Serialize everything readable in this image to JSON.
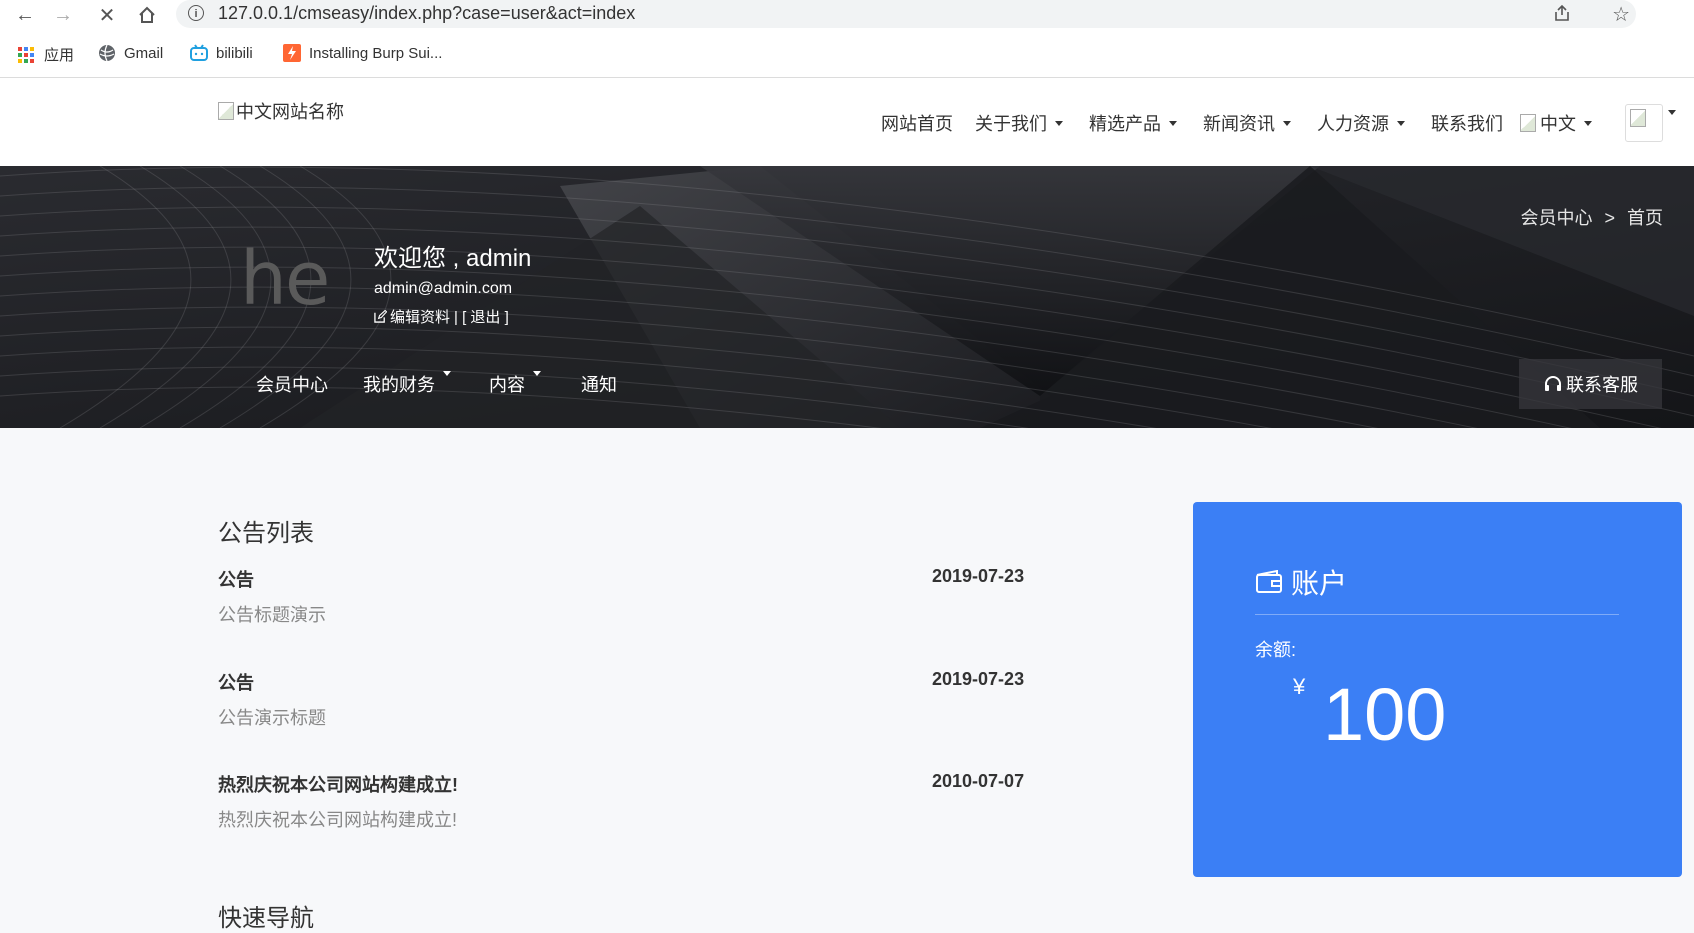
{
  "browser": {
    "url": "127.0.0.1/cmseasy/index.php?case=user&act=index",
    "bookmarks": [
      {
        "label": "应用",
        "icon": "apps-grid-icon"
      },
      {
        "label": "Gmail",
        "icon": "globe-icon"
      },
      {
        "label": "bilibili",
        "icon": "bilibili-icon"
      },
      {
        "label": "Installing Burp Sui...",
        "icon": "burp-icon"
      }
    ]
  },
  "header": {
    "logo_alt": "中文网站名称",
    "nav": [
      {
        "label": "网站首页",
        "dropdown": false
      },
      {
        "label": "关于我们",
        "dropdown": true
      },
      {
        "label": "精选产品",
        "dropdown": true
      },
      {
        "label": "新闻资讯",
        "dropdown": true
      },
      {
        "label": "人力资源",
        "dropdown": true
      },
      {
        "label": "联系我们",
        "dropdown": false
      }
    ],
    "language": "中文"
  },
  "banner": {
    "breadcrumb": {
      "parent": "会员中心",
      "separator": ">",
      "current": "首页"
    },
    "avatar_text": "he",
    "welcome": "欢迎您 , admin",
    "email": "admin@admin.com",
    "edit_profile": "编辑资料",
    "logout": "| [ 退出 ]",
    "member_nav": [
      {
        "label": "会员中心",
        "dropdown": false
      },
      {
        "label": "我的财务",
        "dropdown": true
      },
      {
        "label": "内容",
        "dropdown": true
      },
      {
        "label": "通知",
        "dropdown": false
      }
    ],
    "support_button": "联系客服"
  },
  "notices": {
    "title": "公告列表",
    "items": [
      {
        "title": "公告",
        "date": "2019-07-23",
        "subtitle": "公告标题演示"
      },
      {
        "title": "公告",
        "date": "2019-07-23",
        "subtitle": "公告演示标题"
      },
      {
        "title": "热烈庆祝本公司网站构建成立!",
        "date": "2010-07-07",
        "subtitle": "热烈庆祝本公司网站构建成立!"
      }
    ]
  },
  "quick_nav": {
    "title": "快速导航"
  },
  "account": {
    "title": "账户",
    "balance_label": "余额:",
    "currency": "¥",
    "balance": "100",
    "card_color": "#3b7ff5"
  }
}
